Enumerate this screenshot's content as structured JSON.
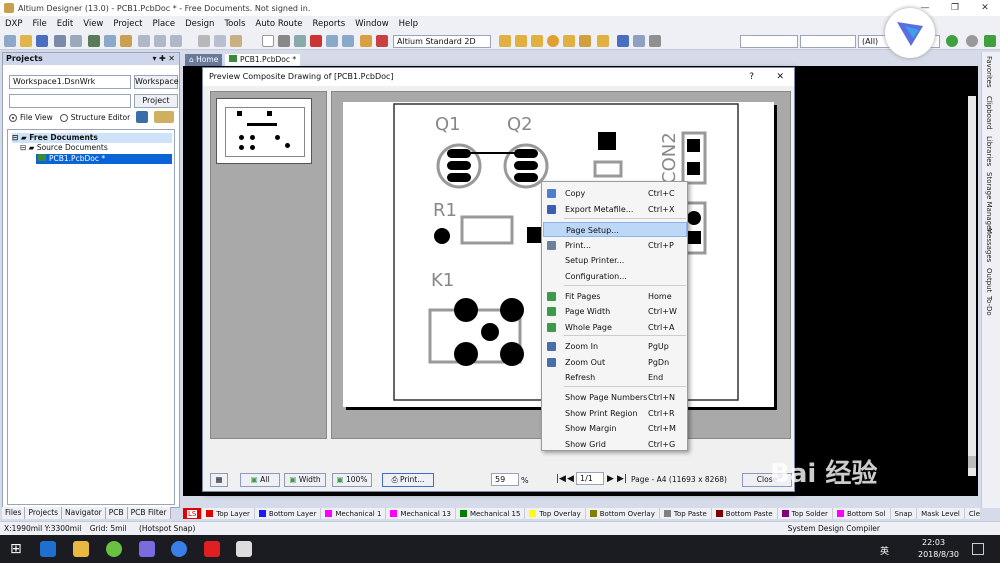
{
  "title_bar": {
    "title": "Altium Designer (13.0) - PCB1.PcbDoc * - Free Documents. Not signed in.",
    "minimize": "—",
    "maximize": "❐",
    "close": "✕"
  },
  "menu": [
    "DXP",
    "File",
    "Edit",
    "View",
    "Project",
    "Place",
    "Design",
    "Tools",
    "Auto Route",
    "Reports",
    "Window",
    "Help"
  ],
  "toolbar": {
    "view_combo": "Altium Standard 2D",
    "filter_combo": "(All)"
  },
  "projects_panel": {
    "title": "Projects",
    "workspace_value": "Workspace1.DsnWrk",
    "workspace_btn": "Workspace",
    "project_btn": "Project",
    "file_view": "File View",
    "structure_editor": "Structure Editor",
    "tree": {
      "free": "Free Documents",
      "source": "Source Documents",
      "doc": "PCB1.PcbDoc *"
    }
  },
  "panel_tabs": [
    "Files",
    "Projects",
    "Navigator",
    "PCB",
    "PCB Filter"
  ],
  "doc_tabs": {
    "home": "Home",
    "doc": "PCB1.PcbDoc *"
  },
  "right_tabs": [
    "Favorites",
    "Clipboard",
    "Libraries",
    "Storage Manager",
    "Messages",
    "Output",
    "To-Do"
  ],
  "dialog": {
    "title": "Preview Composite Drawing of [PCB1.PcbDoc]",
    "help": "?",
    "close_x": "✕",
    "pcb_labels": {
      "q1": "Q1",
      "q2": "Q2",
      "r1": "R1",
      "k1": "K1",
      "con2": "CON2"
    },
    "buttons": {
      "all": "All",
      "width": "Width",
      "pct100": "100%",
      "print": "Print...",
      "close": "Close"
    },
    "zoom_value": "59",
    "zoom_unit": "%",
    "page_value": "1/1",
    "page_info": "Page - A4 (11693 x 8268)"
  },
  "context_menu": [
    {
      "label": "Copy",
      "shortcut": "Ctrl+C",
      "icon": "copy-icon",
      "color": "#4a7fd0"
    },
    {
      "label": "Export Metafile...",
      "shortcut": "Ctrl+X",
      "icon": "save-icon",
      "color": "#3a5fb0"
    },
    {
      "label": "Page Setup...",
      "shortcut": "",
      "icon": "",
      "color": ""
    },
    {
      "label": "Print...",
      "shortcut": "Ctrl+P",
      "icon": "print-icon",
      "color": "#6d7f99"
    },
    {
      "label": "Setup Printer...",
      "shortcut": "",
      "icon": "",
      "color": ""
    },
    {
      "label": "Configuration...",
      "shortcut": "",
      "icon": "",
      "color": ""
    },
    {
      "label": "Fit Pages",
      "shortcut": "Home",
      "icon": "fit-pages-icon",
      "color": "#3c9a4a"
    },
    {
      "label": "Page Width",
      "shortcut": "Ctrl+W",
      "icon": "page-width-icon",
      "color": "#3c9a4a"
    },
    {
      "label": "Whole Page",
      "shortcut": "Ctrl+A",
      "icon": "whole-page-icon",
      "color": "#3c9a4a"
    },
    {
      "label": "Zoom In",
      "shortcut": "PgUp",
      "icon": "zoom-in-icon",
      "color": "#4a6ea8"
    },
    {
      "label": "Zoom Out",
      "shortcut": "PgDn",
      "icon": "zoom-out-icon",
      "color": "#4a6ea8"
    },
    {
      "label": "Refresh",
      "shortcut": "End",
      "icon": "",
      "color": ""
    },
    {
      "label": "Show Page Numbers",
      "shortcut": "Ctrl+N",
      "icon": "",
      "color": ""
    },
    {
      "label": "Show Print Region",
      "shortcut": "Ctrl+R",
      "icon": "",
      "color": ""
    },
    {
      "label": "Show Margin",
      "shortcut": "Ctrl+M",
      "icon": "",
      "color": ""
    },
    {
      "label": "Show Grid",
      "shortcut": "Ctrl+G",
      "icon": "",
      "color": ""
    }
  ],
  "layers": [
    {
      "name": "",
      "color": "#e00000",
      "num": "LS"
    },
    {
      "name": "Top Layer",
      "color": "#e00000"
    },
    {
      "name": "Bottom Layer",
      "color": "#1a1aff"
    },
    {
      "name": "Mechanical 1",
      "color": "#ff00ff"
    },
    {
      "name": "Mechanical 13",
      "color": "#ff00ff"
    },
    {
      "name": "Mechanical 15",
      "color": "#008000"
    },
    {
      "name": "Top Overlay",
      "color": "#ffff00"
    },
    {
      "name": "Bottom Overlay",
      "color": "#808000"
    },
    {
      "name": "Top Paste",
      "color": "#808080"
    },
    {
      "name": "Bottom Paste",
      "color": "#800000"
    },
    {
      "name": "Top Solder",
      "color": "#800080"
    },
    {
      "name": "Bottom Sol",
      "color": "#ff00ff"
    }
  ],
  "layer_extras": [
    "Snap",
    "Mask Level",
    "Clear"
  ],
  "status": {
    "coords": "X:1990mil Y:3300mil",
    "grid": "Grid: 5mil",
    "snap": "(Hotspot Snap)",
    "right": "System  Design Compiler"
  },
  "taskbar": {
    "time": "22:03",
    "date": "2018/8/30",
    "ime": "英"
  },
  "watermark": "Bai 经验"
}
